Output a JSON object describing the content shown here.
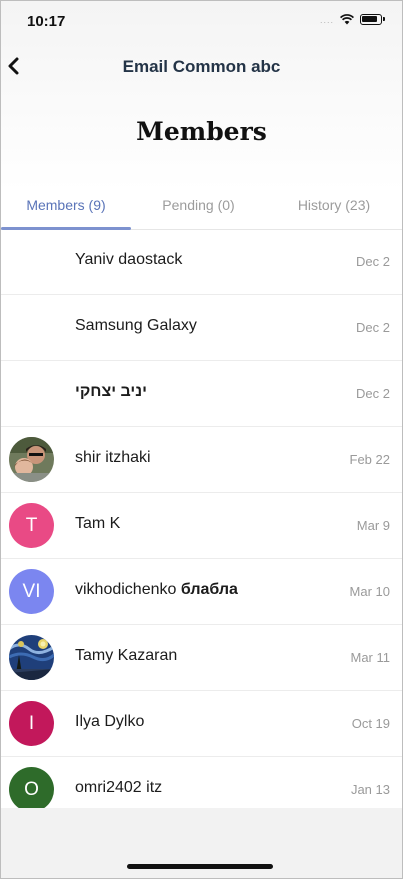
{
  "status": {
    "time": "10:17",
    "signal": "....",
    "icons": [
      "signal-icon",
      "wifi-icon",
      "battery-icon"
    ]
  },
  "nav": {
    "back_icon": "chevron-left-icon",
    "title": "Email Common abc"
  },
  "page": {
    "title": "Members"
  },
  "tabs": [
    {
      "label": "Members (9)",
      "active": true
    },
    {
      "label": "Pending (0)",
      "active": false
    },
    {
      "label": "History (23)",
      "active": false
    }
  ],
  "members": [
    {
      "name": "Yaniv daostack",
      "date": "Dec 2",
      "avatar": {
        "type": "none"
      }
    },
    {
      "name": "Samsung Galaxy",
      "date": "Dec 2",
      "avatar": {
        "type": "none"
      }
    },
    {
      "name": "יניב יצחקי",
      "date": "Dec 2",
      "avatar": {
        "type": "none"
      }
    },
    {
      "name": "shir itzhaki",
      "date": "Feb 22",
      "avatar": {
        "type": "photo"
      }
    },
    {
      "name": "Tam K",
      "date": "Mar 9",
      "avatar": {
        "type": "initials",
        "text": "T",
        "color": "#e94a85"
      }
    },
    {
      "name": "vikhodichenko",
      "name_suffix": "блабла",
      "date": "Mar 10",
      "avatar": {
        "type": "initials",
        "text": "VI",
        "color": "#7b86f0"
      }
    },
    {
      "name": "Tamy Kazaran",
      "date": "Mar 11",
      "avatar": {
        "type": "photo"
      }
    },
    {
      "name": "Ilya Dylko",
      "date": "Oct 19",
      "avatar": {
        "type": "initials",
        "text": "I",
        "color": "#c2185b"
      }
    },
    {
      "name": "omri2402 itz",
      "date": "Jan 13",
      "avatar": {
        "type": "initials",
        "text": "O",
        "color": "#2e6b2a"
      }
    }
  ],
  "colors": {
    "accent": "#5a74b8",
    "tab_underline": "#7d92cf",
    "muted": "#9a9a9a"
  }
}
